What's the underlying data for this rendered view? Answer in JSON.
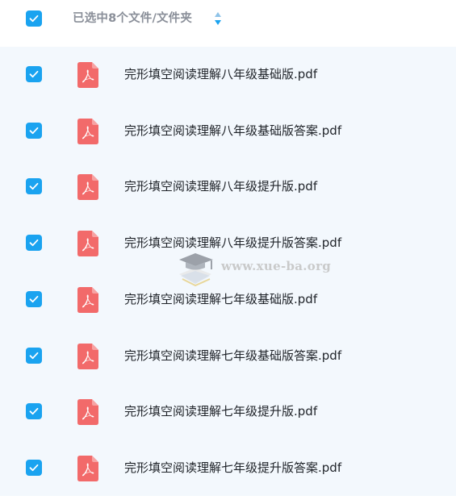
{
  "header": {
    "selection_label": "已选中8个文件/文件夹",
    "select_all_checked": true,
    "sort_icon": "sort-updown-icon"
  },
  "files": [
    {
      "name": "完形填空阅读理解八年级基础版.pdf",
      "checked": true,
      "icon": "pdf-icon"
    },
    {
      "name": "完形填空阅读理解八年级基础版答案.pdf",
      "checked": true,
      "icon": "pdf-icon"
    },
    {
      "name": "完形填空阅读理解八年级提升版.pdf",
      "checked": true,
      "icon": "pdf-icon"
    },
    {
      "name": "完形填空阅读理解八年级提升版答案.pdf",
      "checked": true,
      "icon": "pdf-icon"
    },
    {
      "name": "完形填空阅读理解七年级基础版.pdf",
      "checked": true,
      "icon": "pdf-icon"
    },
    {
      "name": "完形填空阅读理解七年级基础版答案.pdf",
      "checked": true,
      "icon": "pdf-icon"
    },
    {
      "name": "完形填空阅读理解七年级提升版.pdf",
      "checked": true,
      "icon": "pdf-icon"
    },
    {
      "name": "完形填空阅读理解七年级提升版答案.pdf",
      "checked": true,
      "icon": "pdf-icon"
    }
  ],
  "watermark": {
    "text": "www.xue-ba.org"
  },
  "colors": {
    "checkbox": "#1aa3f0",
    "pdf_icon": "#f26a6a",
    "list_background": "#f3f8fd",
    "header_text": "#8a8f99",
    "file_text": "#1f2329"
  }
}
